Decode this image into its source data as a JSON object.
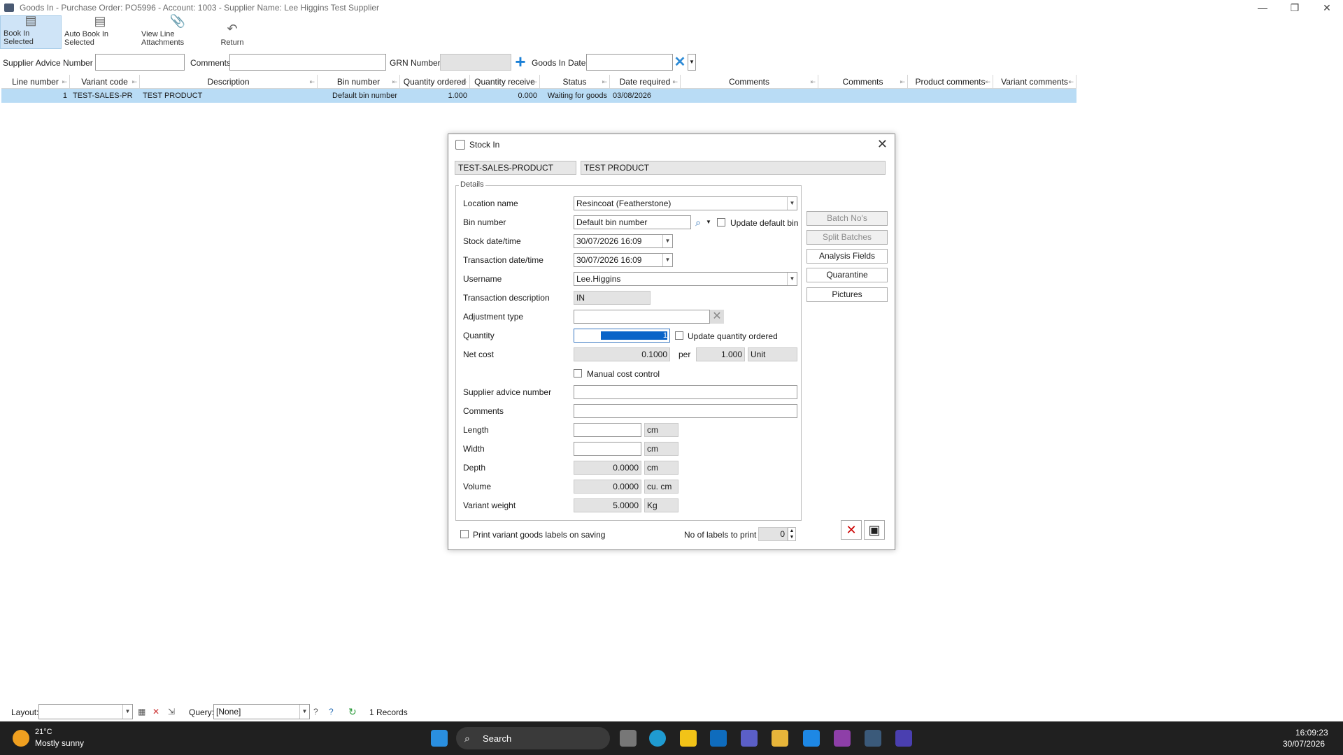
{
  "window": {
    "title": "Goods In - Purchase Order: PO5996 - Account: 1003 - Supplier Name: Lee Higgins Test Supplier",
    "min": "—",
    "max": "❐",
    "close": "✕"
  },
  "ribbon": {
    "book_in_selected": "Book In Selected",
    "auto_book_in_selected": "Auto Book In Selected",
    "view_line_attachments": "View Line Attachments",
    "return": "Return"
  },
  "filter": {
    "supplier_advice_label": "Supplier Advice Number",
    "comments_label": "Comments",
    "grn_label": "GRN Number",
    "goods_in_date_label": "Goods In Date"
  },
  "grid": {
    "headers": [
      "Line number",
      "Variant code",
      "Description",
      "Bin number",
      "Quantity ordered",
      "Quantity receive",
      "Status",
      "Date required",
      "Comments",
      "Comments",
      "Product comments",
      "Variant comments"
    ],
    "row": [
      "1",
      "TEST-SALES-PR",
      "TEST PRODUCT",
      "Default bin number",
      "1.000",
      "0.000",
      "Waiting for goods",
      "03/08/2026",
      "",
      "",
      "",
      ""
    ]
  },
  "dialog": {
    "title": "Stock In",
    "variant_code": "TEST-SALES-PRODUCT",
    "description": "TEST PRODUCT",
    "details_legend": "Details",
    "fields": {
      "location_label": "Location name",
      "location_value": "Resincoat (Featherstone)",
      "bin_label": "Bin number",
      "bin_value": "Default bin number",
      "update_default_bin": "Update default bin",
      "stock_date_label": "Stock date/time",
      "stock_date_value": "30/07/2026 16:09",
      "trans_date_label": "Transaction date/time",
      "trans_date_value": "30/07/2026 16:09",
      "username_label": "Username",
      "username_value": "Lee.Higgins",
      "trans_desc_label": "Transaction description",
      "trans_desc_value": "IN",
      "adjustment_label": "Adjustment type",
      "quantity_label": "Quantity",
      "quantity_value": "1",
      "update_qty_ordered": "Update quantity ordered",
      "net_cost_label": "Net cost",
      "net_cost_value": "0.1000",
      "per_label": "per",
      "per_value": "1.000",
      "unit_value": "Unit",
      "manual_cost": "Manual cost control",
      "supplier_advice_label": "Supplier advice number",
      "comments_label": "Comments",
      "length_label": "Length",
      "length_unit": "cm",
      "width_label": "Width",
      "width_unit": "cm",
      "depth_label": "Depth",
      "depth_value": "0.0000",
      "depth_unit": "cm",
      "volume_label": "Volume",
      "volume_value": "0.0000",
      "volume_unit": "cu. cm",
      "weight_label": "Variant weight",
      "weight_value": "5.0000",
      "weight_unit": "Kg"
    },
    "side_buttons": {
      "batch": "Batch No's",
      "split": "Split Batches",
      "analysis": "Analysis Fields",
      "quarantine": "Quarantine",
      "pictures": "Pictures"
    },
    "print_labels": "Print variant goods labels on saving",
    "no_labels_label": "No of labels to print",
    "no_labels_value": "0"
  },
  "statusbar": {
    "layout_label": "Layout:",
    "query_label": "Query:",
    "query_value": "[None]",
    "records": "1 Records"
  },
  "taskbar": {
    "temp": "21°C",
    "weather": "Mostly sunny",
    "search": "Search",
    "time": "16:09:23",
    "date": "30/07/2026"
  },
  "colors": {
    "selected_row": "#b9dcf5",
    "quantity_highlight": "#0a64c8",
    "taskbar": "#202020"
  }
}
